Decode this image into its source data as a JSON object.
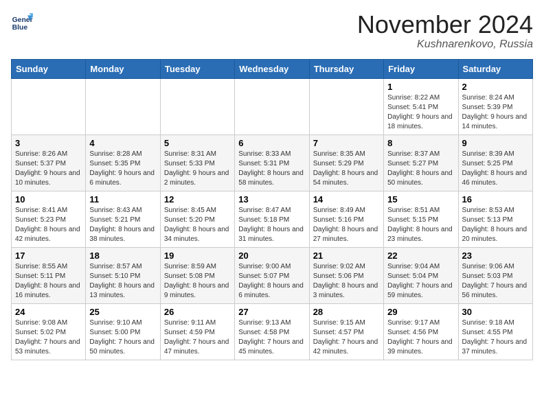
{
  "header": {
    "logo_line1": "General",
    "logo_line2": "Blue",
    "month_title": "November 2024",
    "location": "Kushnarenkovo, Russia"
  },
  "weekdays": [
    "Sunday",
    "Monday",
    "Tuesday",
    "Wednesday",
    "Thursday",
    "Friday",
    "Saturday"
  ],
  "weeks": [
    [
      {
        "day": "",
        "info": ""
      },
      {
        "day": "",
        "info": ""
      },
      {
        "day": "",
        "info": ""
      },
      {
        "day": "",
        "info": ""
      },
      {
        "day": "",
        "info": ""
      },
      {
        "day": "1",
        "info": "Sunrise: 8:22 AM\nSunset: 5:41 PM\nDaylight: 9 hours and 18 minutes."
      },
      {
        "day": "2",
        "info": "Sunrise: 8:24 AM\nSunset: 5:39 PM\nDaylight: 9 hours and 14 minutes."
      }
    ],
    [
      {
        "day": "3",
        "info": "Sunrise: 8:26 AM\nSunset: 5:37 PM\nDaylight: 9 hours and 10 minutes."
      },
      {
        "day": "4",
        "info": "Sunrise: 8:28 AM\nSunset: 5:35 PM\nDaylight: 9 hours and 6 minutes."
      },
      {
        "day": "5",
        "info": "Sunrise: 8:31 AM\nSunset: 5:33 PM\nDaylight: 9 hours and 2 minutes."
      },
      {
        "day": "6",
        "info": "Sunrise: 8:33 AM\nSunset: 5:31 PM\nDaylight: 8 hours and 58 minutes."
      },
      {
        "day": "7",
        "info": "Sunrise: 8:35 AM\nSunset: 5:29 PM\nDaylight: 8 hours and 54 minutes."
      },
      {
        "day": "8",
        "info": "Sunrise: 8:37 AM\nSunset: 5:27 PM\nDaylight: 8 hours and 50 minutes."
      },
      {
        "day": "9",
        "info": "Sunrise: 8:39 AM\nSunset: 5:25 PM\nDaylight: 8 hours and 46 minutes."
      }
    ],
    [
      {
        "day": "10",
        "info": "Sunrise: 8:41 AM\nSunset: 5:23 PM\nDaylight: 8 hours and 42 minutes."
      },
      {
        "day": "11",
        "info": "Sunrise: 8:43 AM\nSunset: 5:21 PM\nDaylight: 8 hours and 38 minutes."
      },
      {
        "day": "12",
        "info": "Sunrise: 8:45 AM\nSunset: 5:20 PM\nDaylight: 8 hours and 34 minutes."
      },
      {
        "day": "13",
        "info": "Sunrise: 8:47 AM\nSunset: 5:18 PM\nDaylight: 8 hours and 31 minutes."
      },
      {
        "day": "14",
        "info": "Sunrise: 8:49 AM\nSunset: 5:16 PM\nDaylight: 8 hours and 27 minutes."
      },
      {
        "day": "15",
        "info": "Sunrise: 8:51 AM\nSunset: 5:15 PM\nDaylight: 8 hours and 23 minutes."
      },
      {
        "day": "16",
        "info": "Sunrise: 8:53 AM\nSunset: 5:13 PM\nDaylight: 8 hours and 20 minutes."
      }
    ],
    [
      {
        "day": "17",
        "info": "Sunrise: 8:55 AM\nSunset: 5:11 PM\nDaylight: 8 hours and 16 minutes."
      },
      {
        "day": "18",
        "info": "Sunrise: 8:57 AM\nSunset: 5:10 PM\nDaylight: 8 hours and 13 minutes."
      },
      {
        "day": "19",
        "info": "Sunrise: 8:59 AM\nSunset: 5:08 PM\nDaylight: 8 hours and 9 minutes."
      },
      {
        "day": "20",
        "info": "Sunrise: 9:00 AM\nSunset: 5:07 PM\nDaylight: 8 hours and 6 minutes."
      },
      {
        "day": "21",
        "info": "Sunrise: 9:02 AM\nSunset: 5:06 PM\nDaylight: 8 hours and 3 minutes."
      },
      {
        "day": "22",
        "info": "Sunrise: 9:04 AM\nSunset: 5:04 PM\nDaylight: 7 hours and 59 minutes."
      },
      {
        "day": "23",
        "info": "Sunrise: 9:06 AM\nSunset: 5:03 PM\nDaylight: 7 hours and 56 minutes."
      }
    ],
    [
      {
        "day": "24",
        "info": "Sunrise: 9:08 AM\nSunset: 5:02 PM\nDaylight: 7 hours and 53 minutes."
      },
      {
        "day": "25",
        "info": "Sunrise: 9:10 AM\nSunset: 5:00 PM\nDaylight: 7 hours and 50 minutes."
      },
      {
        "day": "26",
        "info": "Sunrise: 9:11 AM\nSunset: 4:59 PM\nDaylight: 7 hours and 47 minutes."
      },
      {
        "day": "27",
        "info": "Sunrise: 9:13 AM\nSunset: 4:58 PM\nDaylight: 7 hours and 45 minutes."
      },
      {
        "day": "28",
        "info": "Sunrise: 9:15 AM\nSunset: 4:57 PM\nDaylight: 7 hours and 42 minutes."
      },
      {
        "day": "29",
        "info": "Sunrise: 9:17 AM\nSunset: 4:56 PM\nDaylight: 7 hours and 39 minutes."
      },
      {
        "day": "30",
        "info": "Sunrise: 9:18 AM\nSunset: 4:55 PM\nDaylight: 7 hours and 37 minutes."
      }
    ]
  ]
}
